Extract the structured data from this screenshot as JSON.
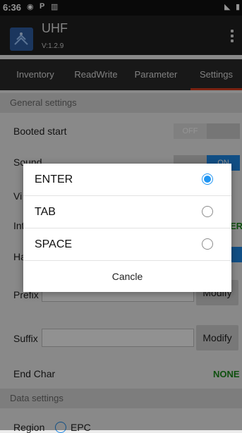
{
  "status": {
    "time": "6:36"
  },
  "app": {
    "title": "UHF",
    "version": "V:1.2.9"
  },
  "tabs": [
    "Inventory",
    "ReadWrite",
    "Parameter",
    "Settings"
  ],
  "sections": {
    "general": "General settings",
    "data": "Data settings"
  },
  "settings": {
    "booted_start": {
      "label": "Booted start",
      "state": "OFF"
    },
    "sound": {
      "label": "Sound",
      "state": "ON"
    },
    "vibrate_partial": "Vi",
    "interface_partial": "Int",
    "interface_value_partial": "ER",
    "handle_partial": "Ha",
    "prefix": {
      "label": "Prefix",
      "button": "Modify"
    },
    "suffix": {
      "label": "Suffix",
      "button": "Modify"
    },
    "end_char": {
      "label": "End Char",
      "value": "NONE"
    },
    "region": {
      "label": "Region",
      "option": "EPC"
    }
  },
  "dialog": {
    "options": [
      {
        "label": "ENTER",
        "selected": true
      },
      {
        "label": "TAB",
        "selected": false
      },
      {
        "label": "SPACE",
        "selected": false
      }
    ],
    "cancel": "Cancle"
  }
}
